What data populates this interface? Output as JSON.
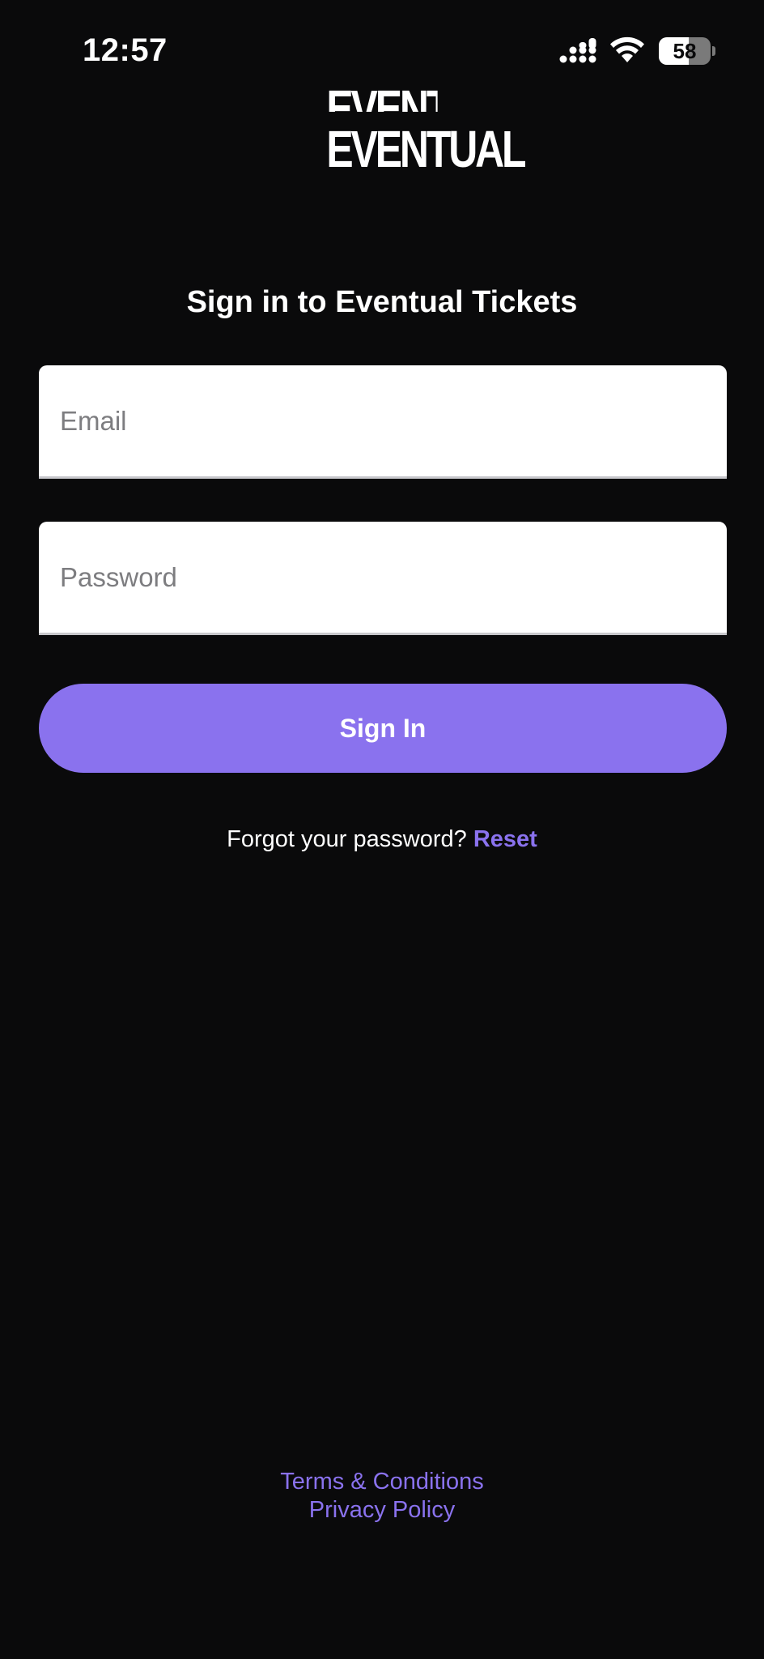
{
  "status_bar": {
    "time": "12:57",
    "battery_level": "58",
    "battery_fraction": 0.58,
    "icons": [
      "signal-icon",
      "wifi-icon",
      "battery-icon"
    ]
  },
  "logo": {
    "text": "EVENTUAL"
  },
  "sign_in": {
    "heading": "Sign in to Eventual Tickets",
    "email_placeholder": "Email",
    "email_value": "",
    "password_placeholder": "Password",
    "password_value": "",
    "button_label": "Sign In",
    "forgot_text": "Forgot your password?",
    "reset_label": "Reset"
  },
  "footer": {
    "terms_label": "Terms & Conditions",
    "privacy_label": "Privacy Policy"
  },
  "colors": {
    "background": "#0a0a0b",
    "accent": "#8a72ee",
    "text": "#ffffff"
  }
}
